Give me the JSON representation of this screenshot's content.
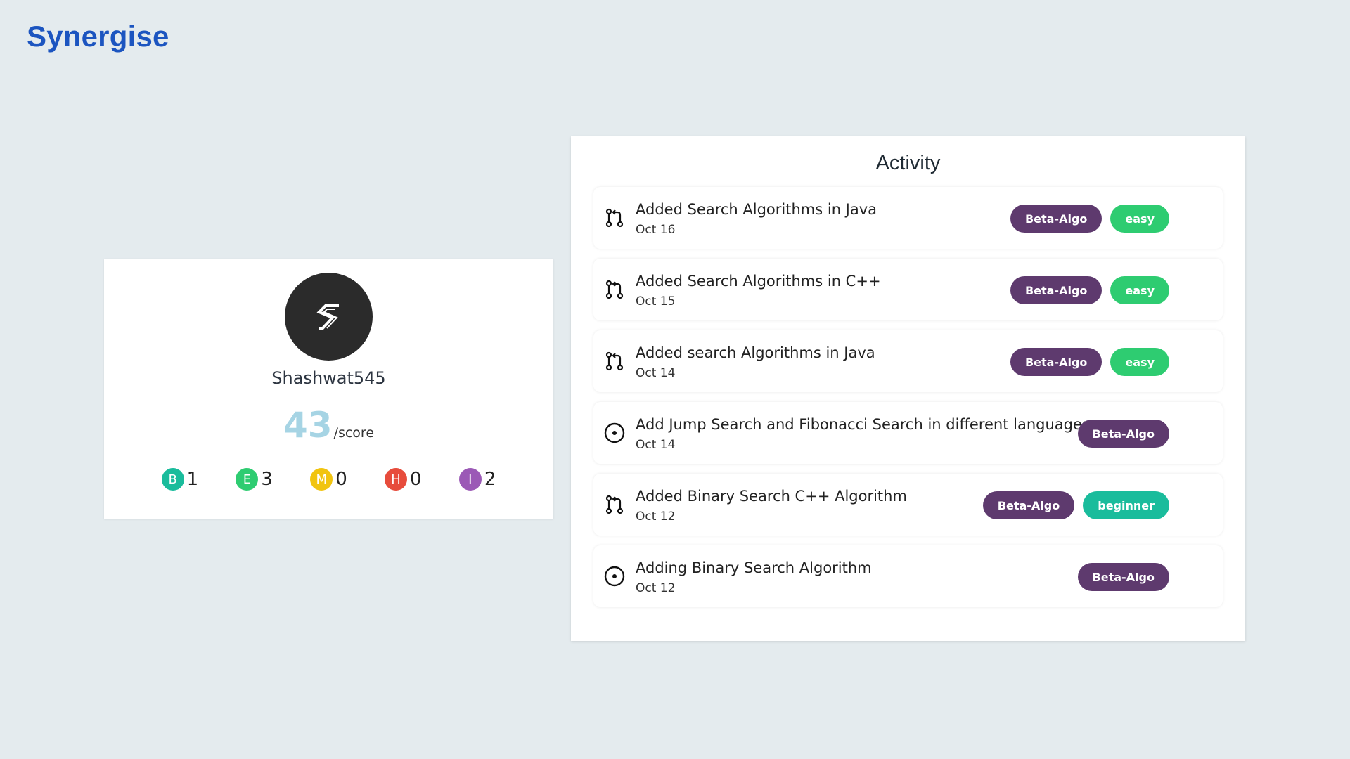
{
  "app": {
    "brand": "Synergise"
  },
  "profile": {
    "username": "Shashwat545",
    "score": "43",
    "score_unit": "/score",
    "counters": [
      {
        "letter": "B",
        "count": "1",
        "color": "#1abc9c"
      },
      {
        "letter": "E",
        "count": "3",
        "color": "#2ecc71"
      },
      {
        "letter": "M",
        "count": "0",
        "color": "#f1c40f"
      },
      {
        "letter": "H",
        "count": "0",
        "color": "#e74c3c"
      },
      {
        "letter": "I",
        "count": "2",
        "color": "#9b59b6"
      }
    ]
  },
  "activity": {
    "title": "Activity",
    "items": [
      {
        "icon": "pull-request-icon",
        "title": "Added Search Algorithms in Java",
        "date": "Oct 16",
        "tags": [
          {
            "label": "Beta-Algo",
            "color": "#5e3a6e"
          },
          {
            "label": "easy",
            "color": "#2ecc71"
          }
        ]
      },
      {
        "icon": "pull-request-icon",
        "title": "Added Search Algorithms in C++",
        "date": "Oct 15",
        "tags": [
          {
            "label": "Beta-Algo",
            "color": "#5e3a6e"
          },
          {
            "label": "easy",
            "color": "#2ecc71"
          }
        ]
      },
      {
        "icon": "pull-request-icon",
        "title": "Added search Algorithms in Java",
        "date": "Oct 14",
        "tags": [
          {
            "label": "Beta-Algo",
            "color": "#5e3a6e"
          },
          {
            "label": "easy",
            "color": "#2ecc71"
          }
        ]
      },
      {
        "icon": "issue-icon",
        "title": "Add Jump Search and Fibonacci Search in different languages",
        "date": "Oct 14",
        "tags": [
          {
            "label": "Beta-Algo",
            "color": "#5e3a6e"
          }
        ]
      },
      {
        "icon": "pull-request-icon",
        "title": "Added Binary Search C++ Algorithm",
        "date": "Oct 12",
        "tags": [
          {
            "label": "Beta-Algo",
            "color": "#5e3a6e"
          },
          {
            "label": "beginner",
            "color": "#1abc9c"
          }
        ]
      },
      {
        "icon": "issue-icon",
        "title": "Adding Binary Search Algorithm",
        "date": "Oct 12",
        "tags": [
          {
            "label": "Beta-Algo",
            "color": "#5e3a6e"
          }
        ]
      }
    ]
  }
}
